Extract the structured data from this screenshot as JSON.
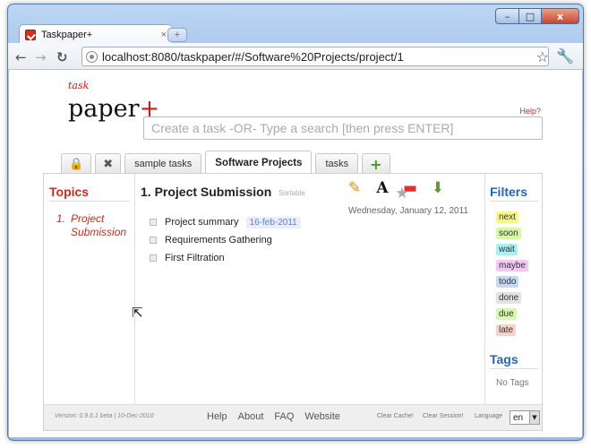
{
  "browser": {
    "tab_title": "Taskpaper+",
    "tab_close": "×",
    "new_tab": "+",
    "url": "localhost:8080/taskpaper/#/Software%20Projects/project/1",
    "back": "←",
    "forward": "→",
    "reload": "↻",
    "bookmark_star": "☆",
    "wrench": "🔧",
    "min": "–",
    "max": "□",
    "close": "x"
  },
  "app": {
    "logo_task": "task",
    "logo_paper": "paper",
    "logo_plus": "+",
    "help": "Help?",
    "search_placeholder": "Create a task -OR- Type a search [then press ENTER]",
    "tabs": [
      {
        "label": "🔒",
        "icon": "lock-icon"
      },
      {
        "label": "✖",
        "icon": "close-icon"
      },
      {
        "label": "sample tasks"
      },
      {
        "label": "Software Projects"
      },
      {
        "label": "tasks"
      },
      {
        "label": "+",
        "icon": "add-icon"
      }
    ]
  },
  "topics": {
    "title": "Topics",
    "items": [
      {
        "num": "1.",
        "label": "Project Submission"
      }
    ]
  },
  "project": {
    "heading": "1. Project Submission",
    "sortable": "Sortable",
    "date": "Wednesday, January 12, 2011",
    "actions": {
      "pencil": "✎",
      "font": "A",
      "minus": "▬",
      "save": "⬇",
      "star": "★"
    },
    "tasks": [
      {
        "label": "Project summary",
        "date": "16-feb-2011"
      },
      {
        "label": "Requirements Gathering"
      },
      {
        "label": "First Filtration"
      }
    ]
  },
  "filters": {
    "title": "Filters",
    "items": [
      {
        "label": "next",
        "color": "#f8f58b"
      },
      {
        "label": "soon",
        "color": "#d7f7a4"
      },
      {
        "label": "wait",
        "color": "#a9f0f4"
      },
      {
        "label": "maybe",
        "color": "#f4c8f4"
      },
      {
        "label": "todo",
        "color": "#c7d8f4"
      },
      {
        "label": "done",
        "color": "#e2e2e2"
      },
      {
        "label": "due",
        "color": "#d7f7b4"
      },
      {
        "label": "late",
        "color": "#f9d3c9"
      }
    ]
  },
  "tags": {
    "title": "Tags",
    "empty": "No Tags"
  },
  "footer": {
    "version": "Version: 0.9.6.1 beta | 10-Dec-2010",
    "links": [
      "Help",
      "About",
      "FAQ",
      "Website"
    ],
    "clear_cache": "Clear Cache!",
    "clear_session": "Clear Session!",
    "language_label": "Language",
    "language_value": "en"
  }
}
